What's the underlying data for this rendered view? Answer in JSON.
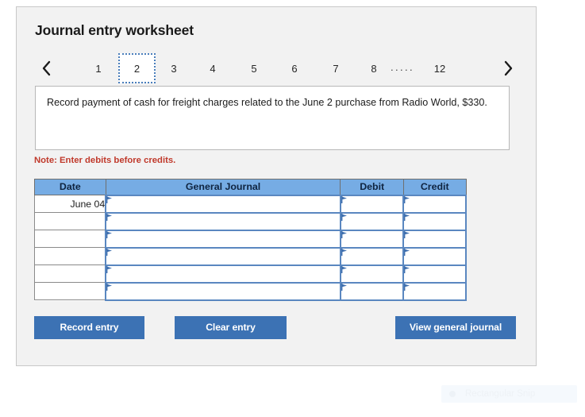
{
  "page": {
    "title": "Journal entry worksheet"
  },
  "pager": {
    "prev_icon": "chevron-left-icon",
    "next_icon": "chevron-right-icon",
    "selected_index": 1,
    "tabs": [
      {
        "label": "1",
        "type": "number",
        "selected": false
      },
      {
        "label": "2",
        "type": "number",
        "selected": true
      },
      {
        "label": "3",
        "type": "number",
        "selected": false
      },
      {
        "label": "4",
        "type": "number",
        "selected": false
      },
      {
        "label": "5",
        "type": "number",
        "selected": false
      },
      {
        "label": "6",
        "type": "number",
        "selected": false
      },
      {
        "label": "7",
        "type": "number",
        "selected": false
      },
      {
        "label": "8",
        "type": "number",
        "selected": false
      },
      {
        "label": ".....",
        "type": "ellipsis",
        "selected": false
      },
      {
        "label": "12",
        "type": "number",
        "selected": false
      }
    ]
  },
  "instruction": {
    "text": "Record payment of cash for freight charges related to the June 2 purchase from Radio World, $330."
  },
  "note": {
    "text": "Note: Enter debits before credits."
  },
  "table": {
    "headers": [
      "Date",
      "General Journal",
      "Debit",
      "Credit"
    ],
    "rows": [
      {
        "date": "June 04",
        "general_journal": "",
        "debit": "",
        "credit": ""
      },
      {
        "date": "",
        "general_journal": "",
        "debit": "",
        "credit": ""
      },
      {
        "date": "",
        "general_journal": "",
        "debit": "",
        "credit": ""
      },
      {
        "date": "",
        "general_journal": "",
        "debit": "",
        "credit": ""
      },
      {
        "date": "",
        "general_journal": "",
        "debit": "",
        "credit": ""
      },
      {
        "date": "",
        "general_journal": "",
        "debit": "",
        "credit": ""
      }
    ]
  },
  "buttons": {
    "record_entry": "Record entry",
    "clear_entry": "Clear entry",
    "view_general_journal": "View general journal"
  },
  "snip_overlay": {
    "label": "Rectangular Snip",
    "icon": "record-dot-icon"
  },
  "colors": {
    "card_background": "#f2f2f2",
    "table_header_blue": "#76ace4",
    "button_blue": "#3c72b4",
    "note_red": "#c0392b",
    "input_border_blue": "#5a87c0",
    "tab_focus_blue": "#4a7ebb"
  }
}
